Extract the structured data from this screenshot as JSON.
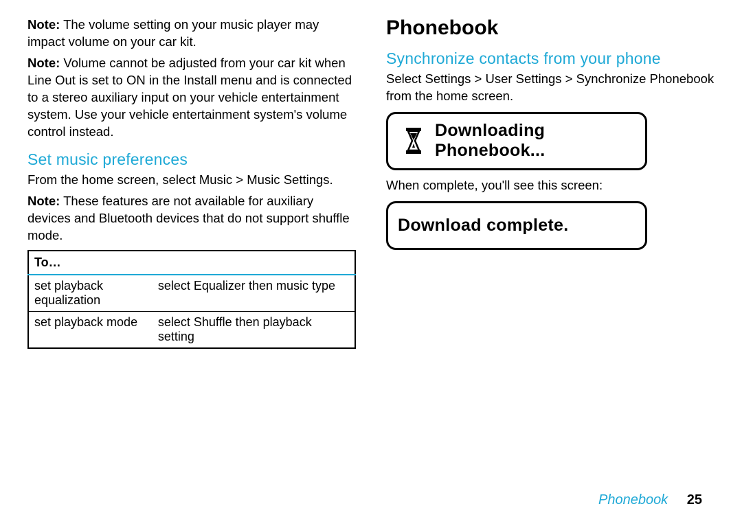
{
  "left": {
    "note1_label": "Note:",
    "note1_text": " The volume setting on your music player may impact volume on your car kit.",
    "note2_label": "Note:",
    "note2_text": " Volume cannot be adjusted from your car kit when Line Out is set to ON in the Install menu and is connected to a stereo auxiliary input on your vehicle entertainment system. Use your vehicle entertainment system's volume control instead.",
    "h2": "Set music preferences",
    "p1": "From the home screen, select Music > Music Settings.",
    "note3_label": "Note:",
    "note3_text": " These features are not available for auxiliary devices and Bluetooth devices that do not support shuffle mode.",
    "table_header": "To…",
    "rows": [
      {
        "a": "set playback equalization",
        "b": "select Equalizer then music type"
      },
      {
        "a": "set playback mode",
        "b": "select Shuffle then playback setting"
      }
    ]
  },
  "right": {
    "h1": "Phonebook",
    "h2": "Synchronize contacts from your phone",
    "p1": "Select Settings > User Settings > Synchronize Phonebook from the home screen.",
    "lcd1_line1": "Downloading",
    "lcd1_line2": "Phonebook...",
    "p2": "When complete, you'll see this screen:",
    "lcd2": "Download complete."
  },
  "footer": {
    "section": "Phonebook",
    "page": "25"
  }
}
